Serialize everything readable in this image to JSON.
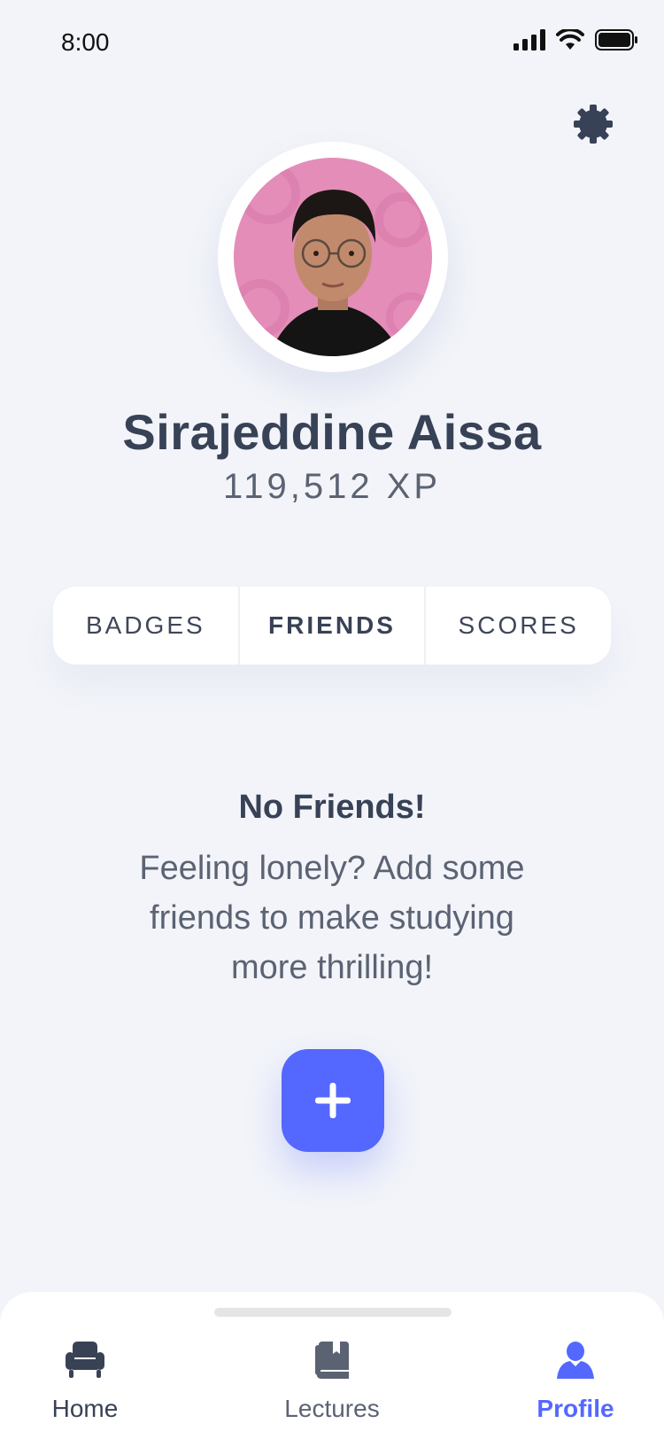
{
  "status_bar": {
    "time": "8:00"
  },
  "profile": {
    "name": "Sirajeddine Aissa",
    "xp": "119,512 XP"
  },
  "tabs": [
    {
      "label": "BADGES",
      "active": false
    },
    {
      "label": "FRIENDS",
      "active": true
    },
    {
      "label": "SCORES",
      "active": false
    }
  ],
  "empty_state": {
    "title": "No Friends!",
    "message": "Feeling lonely? Add some friends to make studying more thrilling!"
  },
  "bottom_nav": [
    {
      "label": "Home",
      "icon": "armchair-icon",
      "active": false
    },
    {
      "label": "Lectures",
      "icon": "book-icon",
      "active": false
    },
    {
      "label": "Profile",
      "icon": "user-icon",
      "active": true
    }
  ],
  "colors": {
    "accent": "#5468ff",
    "background": "#f2f4f9",
    "text": "#384256"
  }
}
